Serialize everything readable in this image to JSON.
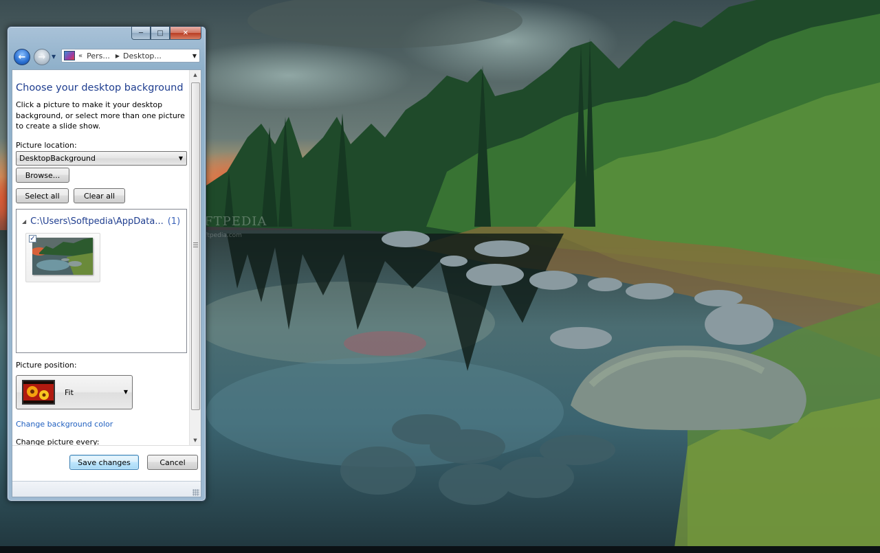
{
  "wallpaper": {
    "watermark": "SOFTPEDIA",
    "watermark_url": "www.softpedia.com"
  },
  "window": {
    "caption": {
      "minimize_icon": "minimize-icon",
      "maximize_icon": "maximize-icon",
      "close_icon": "close-icon"
    },
    "nav": {
      "back_icon": "arrow-left-icon",
      "forward_icon": "arrow-right-icon",
      "breadcrumb_overflow": "«",
      "breadcrumb": [
        "Pers...",
        "Desktop..."
      ]
    },
    "content": {
      "title": "Choose your desktop background",
      "description": "Click a picture to make it your desktop background, or select more than one picture to create a slide show.",
      "picture_location_label": "Picture location:",
      "picture_location_value": "DesktopBackground",
      "browse_label": "Browse...",
      "select_all_label": "Select all",
      "clear_all_label": "Clear all",
      "group": {
        "path": "C:\\Users\\Softpedia\\AppData...",
        "count": "(1)",
        "items": [
          {
            "checked": true,
            "thumbnail": "lake-forest-wallpaper"
          }
        ]
      },
      "picture_position_label": "Picture position:",
      "picture_position_value": "Fit",
      "change_background_color_link": "Change background color",
      "change_picture_every_label": "Change picture every:"
    },
    "footer": {
      "save_label": "Save changes",
      "cancel_label": "Cancel"
    }
  }
}
